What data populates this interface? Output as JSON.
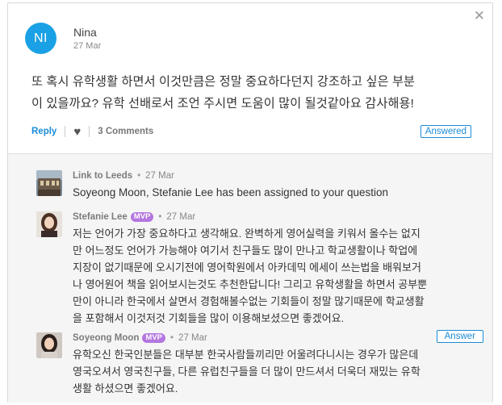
{
  "post": {
    "avatar_initials": "NI",
    "author": "Nina",
    "date": "27 Mar",
    "question_line1": "또 혹시 유학생활 하면서 이것만큼은 정말 중요하다던지 강조하고 싶은 부분",
    "question_line2": "이 있을까요? 유학 선배로서 조언 주시면 도움이 많이 될것같아요 감사해용!"
  },
  "actions": {
    "reply_label": "Reply",
    "comments_label": "3 Comments",
    "answered_label": "Answered"
  },
  "comments": [
    {
      "author": "Link to Leeds",
      "date": "27 Mar",
      "lines": [
        "Soyeong Moon, Stefanie Lee has been assigned to your question"
      ]
    },
    {
      "author": "Stefanie Lee",
      "badge": "MVP",
      "date": "27 Mar",
      "lines": [
        "저는 언어가 가장 중요하다고 생각해요. 완벽하게 영어실력을 키워서 올수는 없지",
        "만 어느정도 언어가 가능해야 여기서 친구들도 많이 만나고 학교생활이나 학업에",
        "지장이 없기때문에 오시기전에 영어학원에서 아카데믹 에세이 쓰는법을 배워보거",
        "나 영어원어 책을 읽어보시는것도 추천한답니다! 그리고 유학생활을 하면서 공부뿐",
        "만이 아니라 한국에서 살면서 경험해볼수없는 기회들이 정말 많기때문에 학교생활",
        "을 포함해서 이것저것 기회들을 많이 이용해보셨으면 좋겠어요."
      ]
    },
    {
      "author": "Soyeong Moon",
      "badge": "MVP",
      "date": "27 Mar",
      "answer_label": "Answer",
      "lines": [
        "유학오신 한국인분들은 대부분 한국사람들끼리만 어울려다니시는 경우가 많은데",
        "영국오셔서 영국친구들, 다른 유럽친구들을 더 많이 만드셔서 더욱더 재밌는 유학",
        "생활 하셨으면 좋겠어요."
      ]
    }
  ],
  "colors": {
    "accent": "#1a8cd8",
    "avatar": "#1aa1e5",
    "mvp": "#b476e0"
  },
  "icons": {
    "close": "close-icon",
    "like": "heart-icon"
  }
}
